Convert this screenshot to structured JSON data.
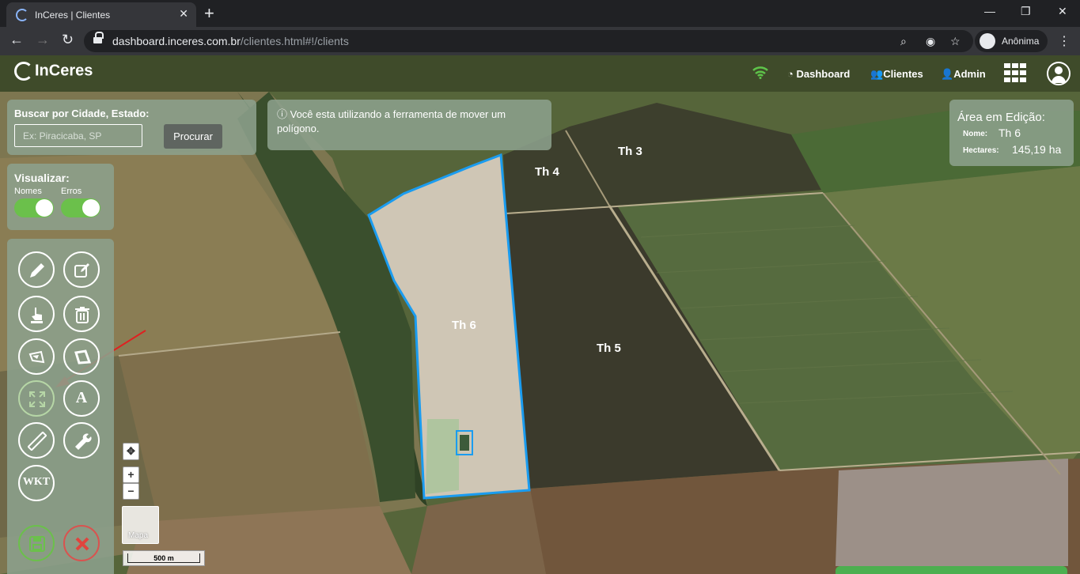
{
  "browser": {
    "tab_title": "InCeres | Clientes",
    "tab_close": "✕",
    "new_tab": "+",
    "url_host": "dashboard.inceres.com.br",
    "url_path": "/clientes.html#!/clients",
    "profile_name": "Anônima",
    "window_controls": [
      "—",
      "❐",
      "✕"
    ]
  },
  "app": {
    "logo_text": "InCeres",
    "nav": {
      "dashboard": "Dashboard",
      "clients": "Clientes",
      "admin": "Admin"
    },
    "wifi_color": "#5ec44a"
  },
  "search": {
    "label": "Buscar por Cidade, Estado:",
    "placeholder": "Ex: Piracicaba, SP",
    "value": "",
    "button": "Procurar"
  },
  "info": {
    "icon": "question-circle-icon",
    "text": "Você esta utilizando a ferramenta de mover um polígono."
  },
  "area_edit": {
    "title": "Área em Edição:",
    "name_label": "Nome:",
    "name_value": "Th 6",
    "hectares_label": "Hectares:",
    "hectares_value": "145,19 ha"
  },
  "view": {
    "title": "Visualizar:",
    "names_label": "Nomes",
    "errors_label": "Erros",
    "names_on": true,
    "errors_on": true
  },
  "tools": {
    "text_tool": "A",
    "wkt_tool": "WKT"
  },
  "map": {
    "fields": {
      "th3": "Th 3",
      "th4": "Th 4",
      "th5": "Th 5",
      "th6": "Th 6"
    },
    "minimap_label": "Mapa",
    "scale_label": "500 m",
    "zoom_in": "+",
    "zoom_out": "−",
    "polygon_outline_color": "#1a9cf0",
    "arrow_color": "#e02020"
  }
}
